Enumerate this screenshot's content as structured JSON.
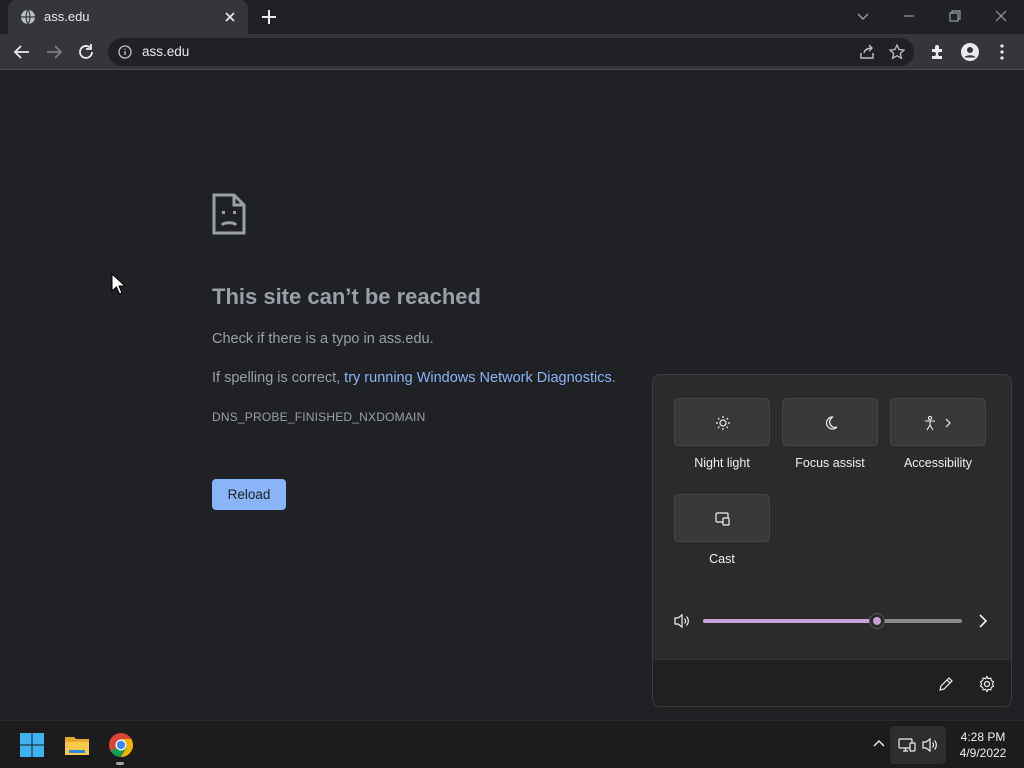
{
  "browser": {
    "tab": {
      "title": "ass.edu",
      "favicon": "globe-icon"
    },
    "omnibox": {
      "url": "ass.edu",
      "security_icon": "info-icon"
    }
  },
  "page": {
    "error_icon": "sad-document-icon",
    "headline": "This site can’t be reached",
    "message1": "Check if there is a typo in ass.edu.",
    "message2_prefix": "If spelling is correct, ",
    "message2_link": "try running Windows Network Diagnostics",
    "message2_suffix": ".",
    "error_code": "DNS_PROBE_FINISHED_NXDOMAIN",
    "reload_label": "Reload",
    "reload_color": "#8ab4f8"
  },
  "quick_settings": {
    "tiles": [
      {
        "label": "Night light",
        "icon": "brightness-icon"
      },
      {
        "label": "Focus assist",
        "icon": "moon-icon"
      },
      {
        "label": "Accessibility",
        "icon": "accessibility-icon"
      },
      {
        "label": "Cast",
        "icon": "cast-icon"
      }
    ],
    "volume_percent": 67,
    "accent": "#c8a2d6"
  },
  "taskbar": {
    "apps": [
      "windows-start-icon",
      "file-explorer-icon",
      "chrome-icon"
    ],
    "time": "4:28 PM",
    "date": "4/9/2022"
  }
}
